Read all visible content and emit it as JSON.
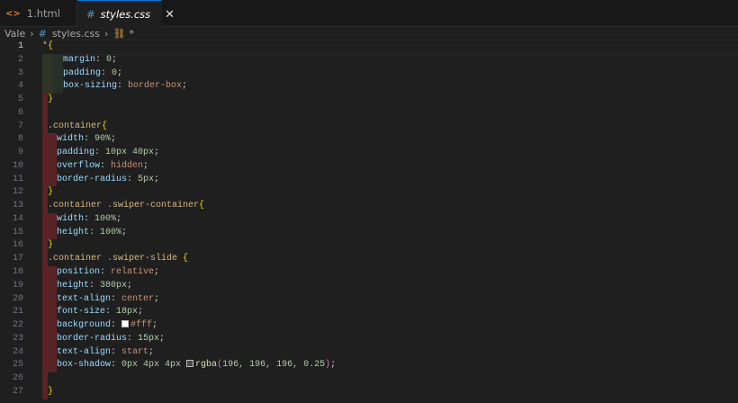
{
  "tabs": [
    {
      "label": "1.html",
      "icon": "html-icon",
      "active": false
    },
    {
      "label": "styles.css",
      "icon": "css-hash-icon",
      "active": true
    }
  ],
  "breadcrumb": {
    "items": [
      "Vale",
      "styles.css",
      "*"
    ]
  },
  "colors": {
    "selector": "#d7ba7d",
    "brace": "#ffd700",
    "property": "#9cdcfe",
    "number": "#b5cea8",
    "value": "#ce9178",
    "function": "#dcdcaa",
    "accent": "#0078d4"
  },
  "lines": [
    {
      "n": 1,
      "deco": "none",
      "indent": 0,
      "tokens": [
        [
          "*",
          "sel"
        ],
        [
          "{",
          "br"
        ]
      ]
    },
    {
      "n": 2,
      "deco": "green",
      "indent": 23,
      "tokens": [
        [
          "margin",
          "prop"
        ],
        [
          ": ",
          "pun"
        ],
        [
          "0",
          "num"
        ],
        [
          ";",
          "pun"
        ]
      ]
    },
    {
      "n": 3,
      "deco": "green",
      "indent": 23,
      "tokens": [
        [
          "padding",
          "prop"
        ],
        [
          ": ",
          "pun"
        ],
        [
          "0",
          "num"
        ],
        [
          ";",
          "pun"
        ]
      ]
    },
    {
      "n": 4,
      "deco": "green",
      "indent": 23,
      "tokens": [
        [
          "box-sizing",
          "prop"
        ],
        [
          ": ",
          "pun"
        ],
        [
          "border-box",
          "val"
        ],
        [
          ";",
          "pun"
        ]
      ]
    },
    {
      "n": 5,
      "deco": "red",
      "indent": 6,
      "tokens": [
        [
          "}",
          "br"
        ]
      ]
    },
    {
      "n": 6,
      "deco": "red",
      "indent": 6,
      "tokens": []
    },
    {
      "n": 7,
      "deco": "red",
      "indent": 6,
      "tokens": [
        [
          ".container",
          "sel"
        ],
        [
          "{",
          "br"
        ]
      ]
    },
    {
      "n": 8,
      "deco": "redi",
      "indent": 16,
      "tokens": [
        [
          "width",
          "prop"
        ],
        [
          ": ",
          "pun"
        ],
        [
          "90%",
          "num"
        ],
        [
          ";",
          "pun"
        ]
      ]
    },
    {
      "n": 9,
      "deco": "redi",
      "indent": 16,
      "tokens": [
        [
          "padding",
          "prop"
        ],
        [
          ": ",
          "pun"
        ],
        [
          "10px 40px",
          "num"
        ],
        [
          ";",
          "pun"
        ]
      ]
    },
    {
      "n": 10,
      "deco": "redi",
      "indent": 16,
      "tokens": [
        [
          "overflow",
          "prop"
        ],
        [
          ": ",
          "pun"
        ],
        [
          "hidden",
          "val"
        ],
        [
          ";",
          "pun"
        ]
      ]
    },
    {
      "n": 11,
      "deco": "redi",
      "indent": 16,
      "tokens": [
        [
          "border-radius",
          "prop"
        ],
        [
          ": ",
          "pun"
        ],
        [
          "5px",
          "num"
        ],
        [
          ";",
          "pun"
        ]
      ]
    },
    {
      "n": 12,
      "deco": "red",
      "indent": 6,
      "tokens": [
        [
          "}",
          "br"
        ]
      ]
    },
    {
      "n": 13,
      "deco": "red",
      "indent": 6,
      "tokens": [
        [
          ".container .swiper-container",
          "sel"
        ],
        [
          "{",
          "br"
        ]
      ]
    },
    {
      "n": 14,
      "deco": "redi",
      "indent": 16,
      "tokens": [
        [
          "width",
          "prop"
        ],
        [
          ": ",
          "pun"
        ],
        [
          "100%",
          "num"
        ],
        [
          ";",
          "pun"
        ]
      ]
    },
    {
      "n": 15,
      "deco": "redi",
      "indent": 16,
      "tokens": [
        [
          "height",
          "prop"
        ],
        [
          ": ",
          "pun"
        ],
        [
          "100%",
          "num"
        ],
        [
          ";",
          "pun"
        ]
      ]
    },
    {
      "n": 16,
      "deco": "red",
      "indent": 6,
      "tokens": [
        [
          "}",
          "br"
        ]
      ]
    },
    {
      "n": 17,
      "deco": "red",
      "indent": 6,
      "tokens": [
        [
          ".container .swiper-slide ",
          "sel"
        ],
        [
          "{",
          "br"
        ]
      ]
    },
    {
      "n": 18,
      "deco": "redi",
      "indent": 16,
      "tokens": [
        [
          "position",
          "prop"
        ],
        [
          ": ",
          "pun"
        ],
        [
          "relative",
          "val"
        ],
        [
          ";",
          "pun"
        ]
      ]
    },
    {
      "n": 19,
      "deco": "redi",
      "indent": 16,
      "tokens": [
        [
          "height",
          "prop"
        ],
        [
          ": ",
          "pun"
        ],
        [
          "380px",
          "num"
        ],
        [
          ";",
          "pun"
        ]
      ]
    },
    {
      "n": 20,
      "deco": "redi",
      "indent": 16,
      "tokens": [
        [
          "text-align",
          "prop"
        ],
        [
          ": ",
          "pun"
        ],
        [
          "center",
          "val"
        ],
        [
          ";",
          "pun"
        ]
      ]
    },
    {
      "n": 21,
      "deco": "redi",
      "indent": 16,
      "tokens": [
        [
          "font-size",
          "prop"
        ],
        [
          ": ",
          "pun"
        ],
        [
          "18px",
          "num"
        ],
        [
          ";",
          "pun"
        ]
      ]
    },
    {
      "n": 22,
      "deco": "redi",
      "indent": 16,
      "tokens": [
        [
          "background",
          "prop"
        ],
        [
          ": ",
          "pun"
        ],
        [
          "#ffffff",
          "swatch"
        ],
        [
          "#fff",
          "val"
        ],
        [
          ";",
          "pun"
        ]
      ]
    },
    {
      "n": 23,
      "deco": "redi",
      "indent": 16,
      "tokens": [
        [
          "border-radius",
          "prop"
        ],
        [
          ": ",
          "pun"
        ],
        [
          "15px",
          "num"
        ],
        [
          ";",
          "pun"
        ]
      ]
    },
    {
      "n": 24,
      "deco": "redi",
      "indent": 16,
      "tokens": [
        [
          "text-align",
          "prop"
        ],
        [
          ": ",
          "pun"
        ],
        [
          "start",
          "val"
        ],
        [
          ";",
          "pun"
        ]
      ]
    },
    {
      "n": 25,
      "deco": "redi",
      "indent": 16,
      "tokens": [
        [
          "box-shadow",
          "prop"
        ],
        [
          ": ",
          "pun"
        ],
        [
          "0px 4px 4px ",
          "num"
        ],
        [
          "#c4c4c440",
          "swatch"
        ],
        [
          "rgba",
          "fn"
        ],
        [
          "(",
          "par"
        ],
        [
          "196, 196, 196, 0.25",
          "num"
        ],
        [
          ")",
          "par"
        ],
        [
          ";",
          "pun"
        ]
      ]
    },
    {
      "n": 26,
      "deco": "red",
      "indent": 6,
      "tokens": []
    },
    {
      "n": 27,
      "deco": "red",
      "indent": 6,
      "tokens": [
        [
          "}",
          "br"
        ]
      ]
    }
  ]
}
